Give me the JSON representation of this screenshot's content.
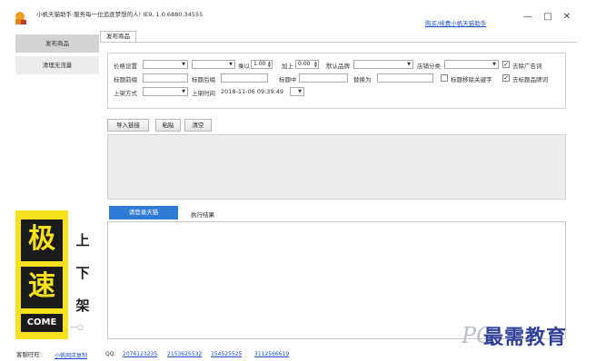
{
  "window": {
    "title": "小帆天猫助手·服务每一位追逐梦想的人! IE9, 1.0.6880.34555",
    "buy_link": "购买/续费小帆天猫助手",
    "minimize": "—",
    "maximize": "□",
    "close": "✕"
  },
  "sidebar": {
    "items": [
      {
        "label": "发布商品"
      },
      {
        "label": "清理无流量"
      }
    ]
  },
  "ad": {
    "chars_left": [
      "极",
      "速"
    ],
    "come": "COME",
    "chars_right": [
      "上",
      "下",
      "架"
    ],
    "dash": "—○"
  },
  "tabs": [
    {
      "label": "发布商品"
    }
  ],
  "form": {
    "price_setting_label": "价格设置",
    "multiply_label": "乘以",
    "multiply_value": "1.00",
    "add_label": "加上",
    "add_value": "0.00",
    "default_brand_label": "默认品牌",
    "shop_category_label": "店铺分类",
    "remove_ads_label": "去除广告词",
    "remove_ads_checked": true,
    "title_prefix_label": "标题前缀",
    "title_suffix_label": "标题后缀",
    "title_middle_label": "标题中",
    "replace_with_label": "替换为",
    "title_remove_keywords_label": "标题移除关键字",
    "title_remove_keywords_checked": false,
    "remove_title_brand_label": "去标题品牌词",
    "remove_title_brand_checked": true,
    "listing_mode_label": "上架方式",
    "listing_time_label": "上架时间",
    "listing_time_value": "2018-11-06 09:39:49",
    "check_mark": "✓",
    "arrow": "▼"
  },
  "buttons": {
    "import_links": "导入链接",
    "paste": "粘贴",
    "clear": "清空"
  },
  "login": {
    "button": "请登录天猫",
    "result_label": "执行结果"
  },
  "footer": {
    "service_label": "客服旺旺:",
    "service_link": "小帆网店复制",
    "qq_label": "QQ:",
    "qq_numbers": [
      "2076123235",
      "2153625532",
      "154525525",
      "3112566619"
    ]
  },
  "watermark": {
    "logo": "PG",
    "text": "最需教育"
  },
  "colors": {
    "accent_blue": "#2f7bd6",
    "link_blue": "#1a4fc4",
    "ad_yellow": "#f5e21c",
    "ad_black": "#1b1b1b",
    "watermark_blue": "#2f3f9a"
  }
}
